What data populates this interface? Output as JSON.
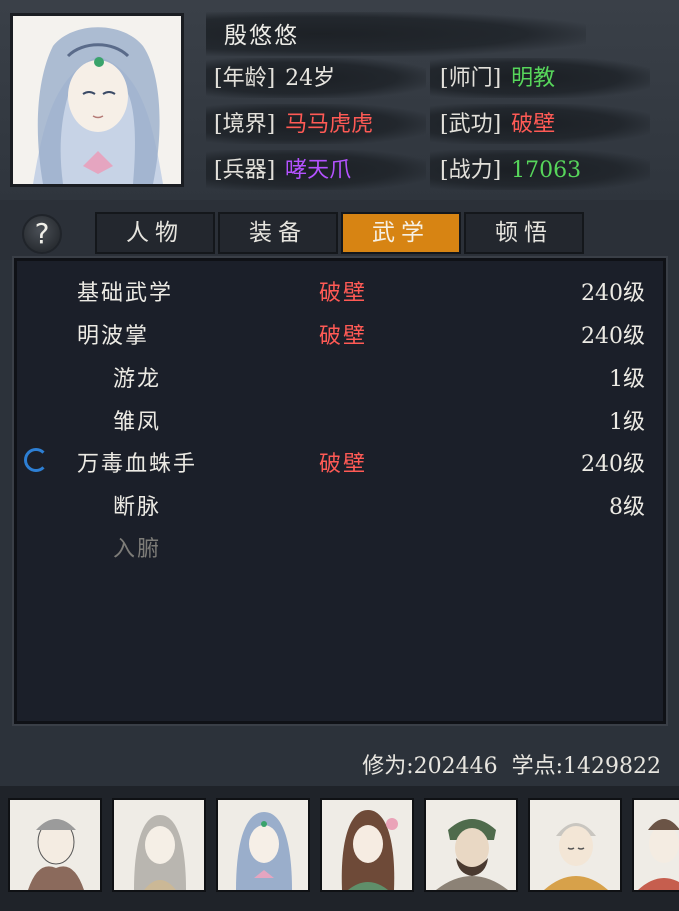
{
  "character": {
    "name": "殷悠悠",
    "attributes": [
      {
        "key": "[年龄]",
        "value": "24岁",
        "color": "#e8e6e0"
      },
      {
        "key": "[师门]",
        "value": "明教",
        "color": "#57d65b"
      },
      {
        "key": "[境界]",
        "value": "马马虎虎",
        "color": "#ff5a55"
      },
      {
        "key": "[武功]",
        "value": "破壁",
        "color": "#ff5a55"
      },
      {
        "key": "[兵器]",
        "value": "哮天爪",
        "color": "#b452ff"
      },
      {
        "key": "[战力]",
        "value": "17063",
        "color": "#57d65b"
      }
    ]
  },
  "help_icon": "question-icon",
  "tabs": [
    {
      "label": "人物",
      "active": false
    },
    {
      "label": "装备",
      "active": false
    },
    {
      "label": "武学",
      "active": true
    },
    {
      "label": "顿悟",
      "active": false
    }
  ],
  "skills": [
    {
      "name": "基础武学",
      "status": "破壁",
      "level": "240级",
      "indent": 0,
      "dim": false
    },
    {
      "name": "明波掌",
      "status": "破壁",
      "level": "240级",
      "indent": 0,
      "dim": false
    },
    {
      "name": "游龙",
      "status": "",
      "level": "1级",
      "indent": 1,
      "dim": false
    },
    {
      "name": "雏凤",
      "status": "",
      "level": "1级",
      "indent": 1,
      "dim": false
    },
    {
      "name": "万毒血蛛手",
      "status": "破壁",
      "level": "240级",
      "indent": 0,
      "dim": false,
      "spinner": true
    },
    {
      "name": "断脉",
      "status": "",
      "level": "8级",
      "indent": 1,
      "dim": false
    },
    {
      "name": "入腑",
      "status": "",
      "level": "",
      "indent": 1,
      "dim": true
    }
  ],
  "footer": {
    "cultivation": "修为:202446",
    "study_points": "学点:1429822"
  },
  "roster_count": 7,
  "colors": {
    "accent_tab": "#d78413",
    "status_red": "#ff5a55",
    "green": "#57d65b",
    "purple": "#b452ff",
    "spinner_blue": "#2d7fd4"
  }
}
